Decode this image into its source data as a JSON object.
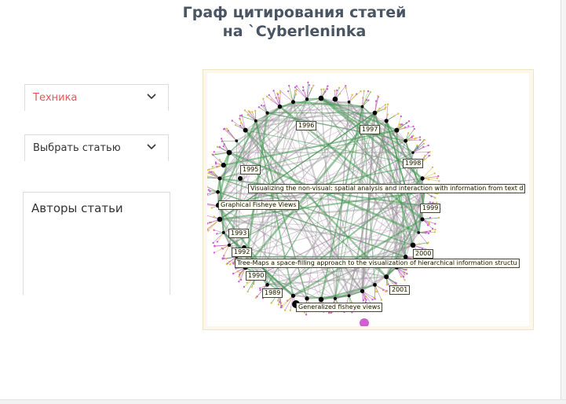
{
  "header": {
    "title_line1": "Граф цитирования статей",
    "title_line2": "на `Cyberleninka"
  },
  "controls": {
    "category_value": "Техника",
    "article_placeholder": "Выбрать статью",
    "authors_label": "Авторы статьи"
  },
  "graph": {
    "year_labels": [
      "1996",
      "1997",
      "1998",
      "1995",
      "1999",
      "1993",
      "1992",
      "2000",
      "1990",
      "2001",
      "1989"
    ],
    "paper_labels": [
      "Visualizing the non-visual: spatial analysis and interaction with information from text d",
      "Graphical Fisheye Views",
      "Tree-Maps a space-filling approach to the visualization of hierarchical information structu",
      "Generalized fisheye views"
    ],
    "colors": {
      "edge_gray": "#9a9a9a",
      "edge_green": "#3f9a4f",
      "edge_pink": "#c070c0",
      "edge_yellow": "#d8c050",
      "node_black": "#000000",
      "node_pink": "#d060d0"
    }
  }
}
